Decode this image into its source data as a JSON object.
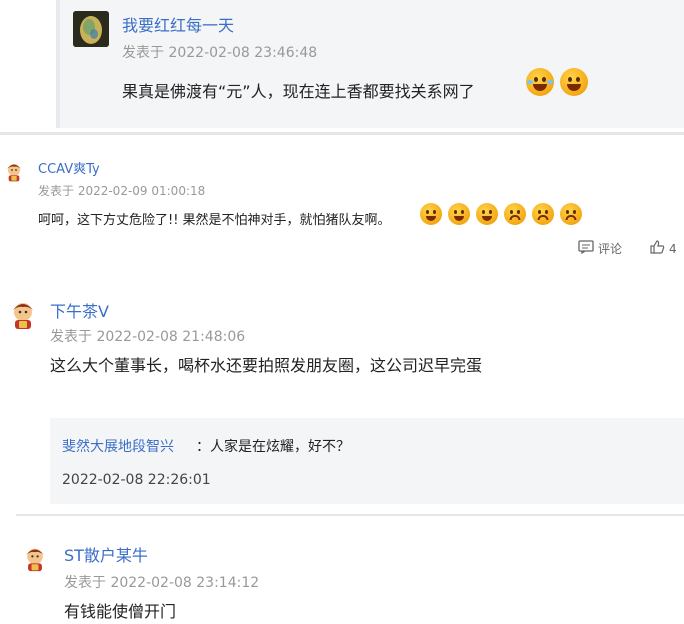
{
  "comments": [
    {
      "name": "我要红红每一天",
      "time": "发表于 2022-02-08 23:46:48",
      "text": "果真是佛渡有“元”人，现在连上香都要找关系网了",
      "emojis": [
        "laugh-cry-emoji",
        "laugh-emoji"
      ]
    },
    {
      "name": "CCAV爽Ty",
      "time": "发表于 2022-02-09 01:00:18",
      "text": "呵呵，这下方丈危险了!! 果然是不怕神对手，就怕猪队友啊。",
      "emojis": [
        "grin-emoji",
        "grin-emoji",
        "grin-emoji",
        "sad-emoji",
        "sad-emoji",
        "sad-emoji"
      ],
      "actions": {
        "comment_label": "评论",
        "like_count": "4"
      }
    },
    {
      "name": "下午茶V",
      "time": "发表于 2022-02-08 21:48:06",
      "text": "这么大个董事长，喝杯水还要拍照发朋友圈，这公司迟早完蛋",
      "reply": {
        "name": "斐然大展地段智兴",
        "text": "：人家是在炫耀，好不？",
        "time": "2022-02-08 22:26:01"
      }
    },
    {
      "name": "ST散户某牛",
      "time": "发表于 2022-02-08 23:14:12",
      "text": "有钱能使僧开门"
    }
  ]
}
